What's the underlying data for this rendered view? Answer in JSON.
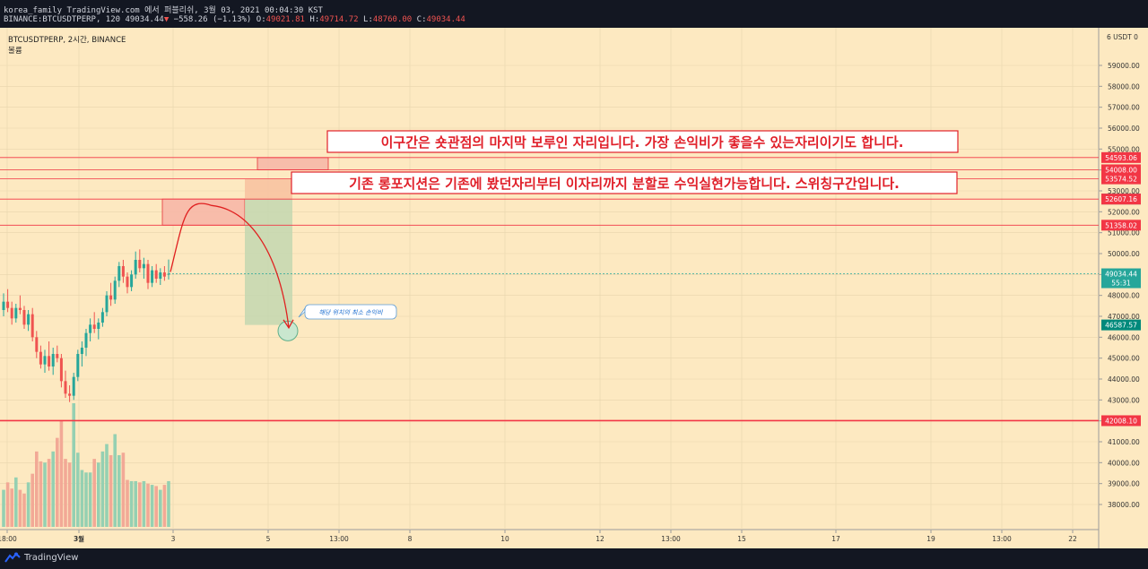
{
  "header": {
    "publish_line": "korea_family TradingView.com 에서 퍼블리쉬, 3월 03, 2021 00:04:30 KST",
    "symbol_prefix": "BINANCE:BTCUSDTPERP, 120 49034.44",
    "change_arrow": "▼",
    "change_text": "−558.26 (−1.13%)",
    "o_label": "O:",
    "o_value": "49021.81",
    "h_label": "H:",
    "h_value": "49714.72",
    "l_label": "L:",
    "l_value": "48760.00",
    "c_label": "C:",
    "c_value": "49034.44"
  },
  "legend": {
    "symbol": "BTCUSDTPERP, 2시간, BINANCE",
    "volume": "볼륨"
  },
  "annotations": {
    "upper_text": "이구간은 숏관점의 마지막 보루인 자리입니다. 가장 손익비가 좋을수 있는자리이기도 합니다.",
    "lower_text": "기존 롱포지션은 기존에 봤던자리부터 이자리까지 분할로 수익실현가능합니다. 스위칭구간입니다.",
    "callout_text": "해당 위치의 최소 손익비"
  },
  "footer": {
    "brand": "TradingView"
  },
  "colors": {
    "background": "#fde9c1",
    "up": "#26a69a",
    "down": "#ef5350",
    "level_line": "#f23645",
    "text_red": "#e0202a"
  },
  "chart_data": {
    "type": "candlestick",
    "symbol": "BTCUSDTPERP",
    "interval": "2시간",
    "exchange": "BINANCE",
    "currency": "USDT",
    "ylim": [
      36800,
      60800
    ],
    "y_ticks": [
      38000,
      39000,
      40000,
      41000,
      42000,
      43000,
      44000,
      45000,
      46000,
      47000,
      48000,
      49000,
      50000,
      51000,
      52000,
      53000,
      54000,
      55000,
      56000,
      57000,
      58000,
      59000
    ],
    "x_ticks": [
      "18:00",
      "3월",
      "3",
      "5",
      "13:00",
      "8",
      "10",
      "12",
      "13:00",
      "15",
      "17",
      "19",
      "13:00",
      "22"
    ],
    "candles": [
      [
        47300,
        48100,
        47000,
        47700
      ],
      [
        47700,
        48300,
        47200,
        47400
      ],
      [
        47400,
        47700,
        46600,
        46900
      ],
      [
        46900,
        47600,
        46700,
        47400
      ],
      [
        47400,
        48000,
        47100,
        47300
      ],
      [
        47300,
        47500,
        46400,
        46600
      ],
      [
        46600,
        47300,
        46300,
        47100
      ],
      [
        47100,
        47400,
        45800,
        46000
      ],
      [
        46000,
        46300,
        45000,
        45300
      ],
      [
        45300,
        45600,
        44500,
        44700
      ],
      [
        44700,
        45400,
        44300,
        45100
      ],
      [
        45100,
        45800,
        44400,
        44600
      ],
      [
        44600,
        45500,
        44200,
        45200
      ],
      [
        45200,
        45600,
        44800,
        45000
      ],
      [
        45000,
        45200,
        43600,
        43900
      ],
      [
        43900,
        44400,
        43100,
        43300
      ],
      [
        43300,
        43700,
        42900,
        43200
      ],
      [
        43200,
        44300,
        43000,
        44100
      ],
      [
        44100,
        45400,
        43900,
        45200
      ],
      [
        45200,
        45800,
        44600,
        45500
      ],
      [
        45500,
        46400,
        45100,
        46200
      ],
      [
        46200,
        46900,
        45800,
        46600
      ],
      [
        46600,
        47200,
        46200,
        46400
      ],
      [
        46400,
        46900,
        45900,
        46700
      ],
      [
        46700,
        47400,
        46500,
        47200
      ],
      [
        47200,
        48200,
        47000,
        48000
      ],
      [
        48000,
        48600,
        47500,
        47800
      ],
      [
        47800,
        48900,
        47600,
        48700
      ],
      [
        48700,
        49600,
        48400,
        49400
      ],
      [
        49400,
        49700,
        48600,
        48900
      ],
      [
        48900,
        49100,
        48100,
        48400
      ],
      [
        48400,
        49200,
        48200,
        49000
      ],
      [
        49000,
        50100,
        48800,
        49700
      ],
      [
        49700,
        50200,
        49100,
        49300
      ],
      [
        49300,
        49800,
        48800,
        49500
      ],
      [
        49500,
        49700,
        48300,
        48600
      ],
      [
        48600,
        49400,
        48400,
        49200
      ],
      [
        49200,
        49500,
        48600,
        48800
      ],
      [
        48800,
        49300,
        48500,
        49100
      ],
      [
        49100,
        49400,
        48700,
        48900
      ],
      [
        49021.81,
        49714.72,
        48760.0,
        49034.44
      ]
    ],
    "volumes": [
      0.3,
      0.36,
      0.31,
      0.4,
      0.3,
      0.27,
      0.36,
      0.43,
      0.61,
      0.53,
      0.52,
      0.55,
      0.61,
      0.72,
      0.86,
      0.55,
      0.52,
      1.0,
      0.6,
      0.46,
      0.44,
      0.44,
      0.55,
      0.52,
      0.61,
      0.67,
      0.58,
      0.75,
      0.58,
      0.6,
      0.38,
      0.37,
      0.37,
      0.36,
      0.37,
      0.35,
      0.34,
      0.33,
      0.3,
      0.34,
      0.37
    ],
    "price_levels": [
      {
        "value": "54593.06",
        "price": 54593.06,
        "style": "tag"
      },
      {
        "value": "54008.00",
        "price": 54008.0,
        "style": "tag"
      },
      {
        "value": "53574.52",
        "price": 53574.52,
        "style": "tag"
      },
      {
        "value": "52609.07",
        "price": 52609.07,
        "style": "gray"
      },
      {
        "value": "52607.16",
        "price": 52607.16,
        "style": "tag"
      },
      {
        "value": "51358.02",
        "price": 51358.02,
        "style": "tag"
      },
      {
        "value": "46587.57",
        "price": 46587.57,
        "style": "teal"
      },
      {
        "value": "42008.10",
        "price": 42008.1,
        "style": "tag"
      }
    ],
    "last_price": {
      "value": "49034.44",
      "countdown": "55:31",
      "price": 49034.44
    },
    "zones": [
      {
        "name": "upper-zone",
        "low": 54008.0,
        "high": 54593.06
      },
      {
        "name": "resistance-zone",
        "low": 51358.02,
        "high": 52607.16
      },
      {
        "name": "target-zone",
        "low": 52607.16,
        "high": 53574.52
      },
      {
        "name": "reward-zone",
        "low": 46587.57,
        "high": 52607.16
      }
    ]
  }
}
